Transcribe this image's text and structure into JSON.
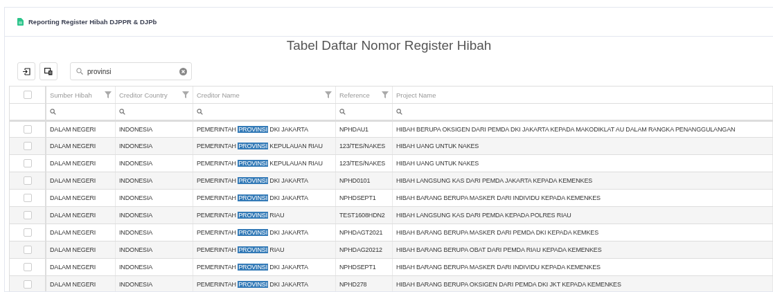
{
  "panel": {
    "title": "Reporting Register Hibah DJPPR & DJPb"
  },
  "heading": "Tabel Daftar Nomor Register Hibah",
  "search": {
    "value": "provinsi"
  },
  "table": {
    "select_all": {
      "checked": false
    },
    "columns": [
      {
        "label": "Sumber Hibah",
        "filter": true
      },
      {
        "label": "Creditor Country",
        "filter": true
      },
      {
        "label": "Creditor Name",
        "filter": true
      },
      {
        "label": "Reference",
        "filter": true
      },
      {
        "label": "Project Name",
        "filter": false
      }
    ],
    "rows": [
      {
        "checked": false,
        "sumber": "DALAM NEGERI",
        "country": "INDONESIA",
        "creditor": {
          "before": "PEMERINTAH ",
          "match": "PROVINSI",
          "after": " DKI JAKARTA"
        },
        "reference": "NPHDAU1",
        "project": "HIBAH BERUPA OKSIGEN DARI PEMDA DKI JAKARTA KEPADA MAKODIKLAT AU DALAM RANGKA PENANGGULANGAN"
      },
      {
        "checked": false,
        "sumber": "DALAM NEGERI",
        "country": "INDONESIA",
        "creditor": {
          "before": "PEMERINTAH ",
          "match": "PROVINSI",
          "after": " KEPULAUAN RIAU"
        },
        "reference": "123/TES/NAKES",
        "project": "HIBAH UANG UNTUK NAKES"
      },
      {
        "checked": false,
        "sumber": "DALAM NEGERI",
        "country": "INDONESIA",
        "creditor": {
          "before": "PEMERINTAH ",
          "match": "PROVINSI",
          "after": " KEPULAUAN RIAU"
        },
        "reference": "123/TES/NAKES",
        "project": "HIBAH UANG UNTUK NAKES"
      },
      {
        "checked": false,
        "sumber": "DALAM NEGERI",
        "country": "INDONESIA",
        "creditor": {
          "before": "PEMERINTAH ",
          "match": "PROVINSI",
          "after": " DKI JAKARTA"
        },
        "reference": "NPHD0101",
        "project": "HIBAH LANGSUNG KAS DARI PEMDA JAKARTA KEPADA KEMENKES"
      },
      {
        "checked": false,
        "sumber": "DALAM NEGERI",
        "country": "INDONESIA",
        "creditor": {
          "before": "PEMERINTAH ",
          "match": "PROVINSI",
          "after": " DKI JAKARTA"
        },
        "reference": "NPHDSEPT1",
        "project": "HIBAH BARANG BERUPA MASKER DARI INDIVIDU KEPADA KEMENKES"
      },
      {
        "checked": false,
        "sumber": "DALAM NEGERI",
        "country": "INDONESIA",
        "creditor": {
          "before": "PEMERINTAH ",
          "match": "PROVINSI",
          "after": " RIAU"
        },
        "reference": "TEST1608HDN2",
        "project": "HIBAH LANGSUNG KAS DARI PEMDA KEPADA POLRES RIAU"
      },
      {
        "checked": false,
        "sumber": "DALAM NEGERI",
        "country": "INDONESIA",
        "creditor": {
          "before": "PEMERINTAH ",
          "match": "PROVINSI",
          "after": " DKI JAKARTA"
        },
        "reference": "NPHDAGT2021",
        "project": "HIBAH BARANG BERUPA MASKER DARI PEMDA DKI KEPADA KEMKES"
      },
      {
        "checked": false,
        "sumber": "DALAM NEGERI",
        "country": "INDONESIA",
        "creditor": {
          "before": "PEMERINTAH ",
          "match": "PROVINSI",
          "after": " RIAU"
        },
        "reference": "NPHDAG20212",
        "project": "HIBAH BARANG BERUPA OBAT DARI PEMDA RIAU KEPADA KEMENKES"
      },
      {
        "checked": false,
        "sumber": "DALAM NEGERI",
        "country": "INDONESIA",
        "creditor": {
          "before": "PEMERINTAH ",
          "match": "PROVINSI",
          "after": " DKI JAKARTA"
        },
        "reference": "NPHDSEPT1",
        "project": "HIBAH BARANG BERUPA MASKER DARI INDIVIDU KEPADA KEMENKES"
      },
      {
        "checked": false,
        "sumber": "DALAM NEGERI",
        "country": "INDONESIA",
        "creditor": {
          "before": "PEMERINTAH ",
          "match": "PROVINSI",
          "after": " DKI JAKARTA"
        },
        "reference": "NPHD278",
        "project": "HIBAH BARANG BERUPA OKSIGEN DARI PEMDA DKI JKT KEPADA KEMENKES"
      }
    ]
  }
}
